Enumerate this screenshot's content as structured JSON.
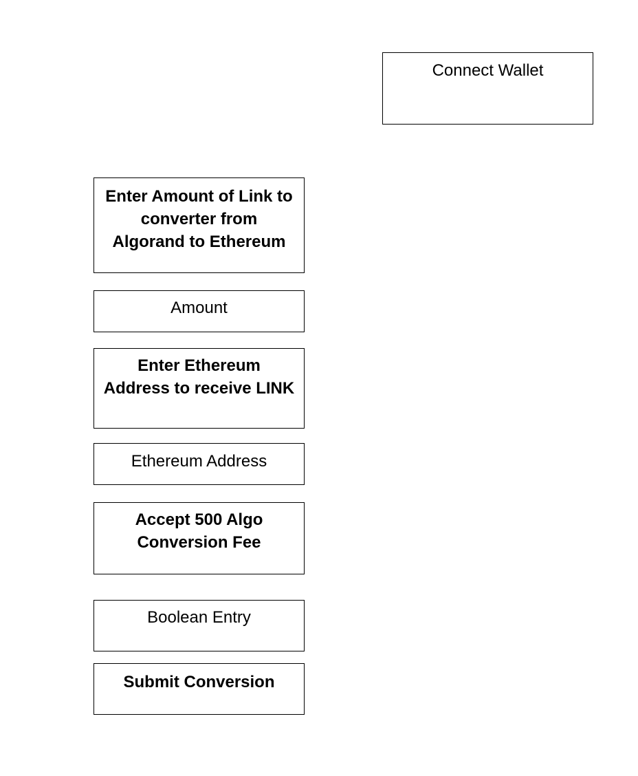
{
  "connect_wallet": {
    "label": "Connect Wallet"
  },
  "amount_section": {
    "instruction_lines": [
      "Enter Amount of Link to",
      "converter from",
      "Algorand to Ethereum"
    ],
    "field_label": "Amount"
  },
  "address_section": {
    "instruction_lines": [
      "Enter Ethereum",
      "Address to receive LINK"
    ],
    "field_label": "Ethereum Address"
  },
  "fee_section": {
    "instruction_lines": [
      "Accept 500 Algo",
      "Conversion Fee"
    ],
    "field_label": "Boolean Entry"
  },
  "submit": {
    "label": "Submit Conversion"
  }
}
